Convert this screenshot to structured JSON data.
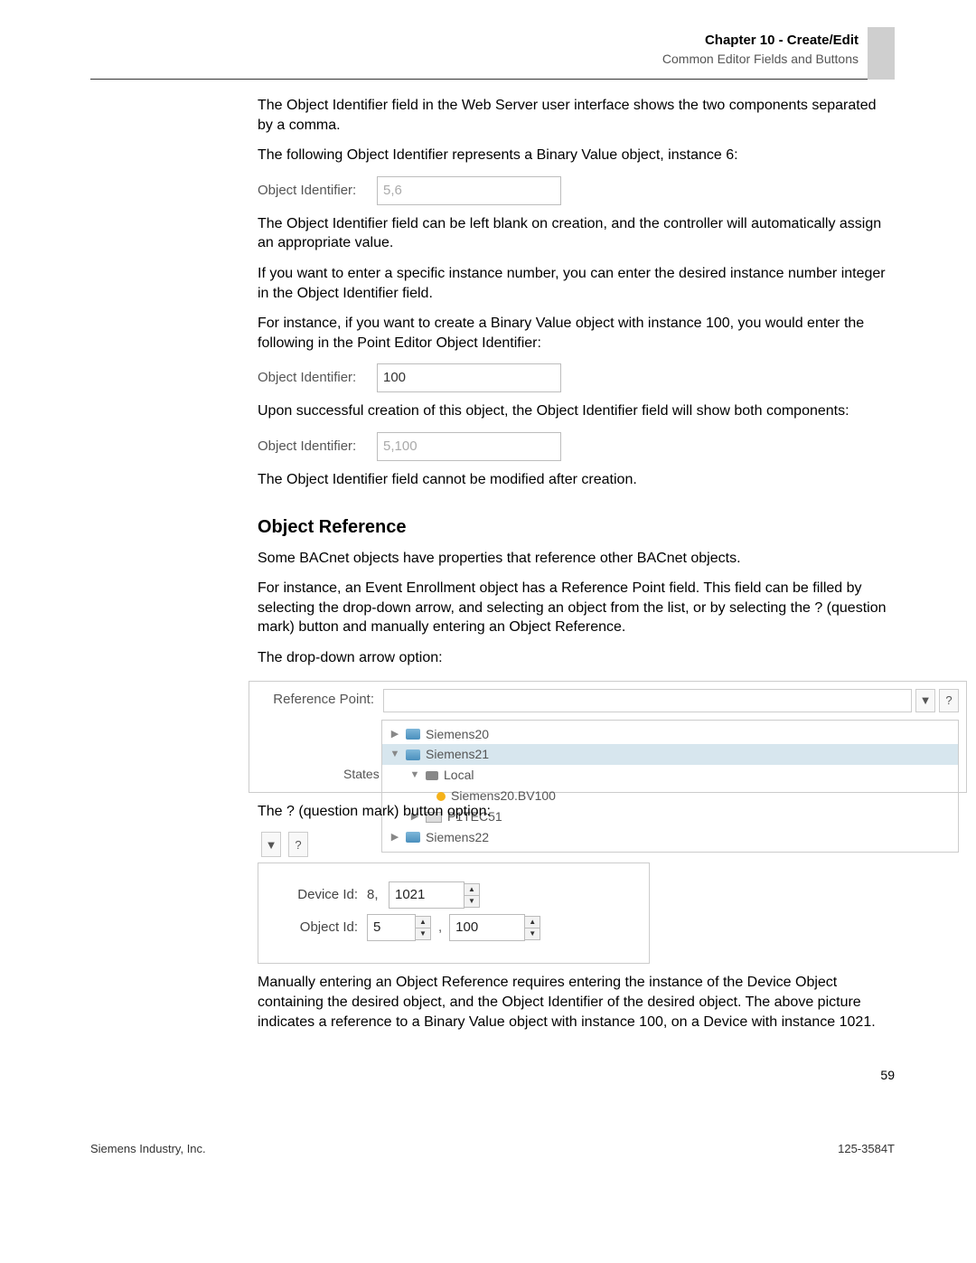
{
  "header": {
    "chapter": "Chapter 10 - Create/Edit",
    "subtitle": "Common Editor Fields and Buttons"
  },
  "body": {
    "p1": "The Object Identifier field in the Web Server user interface shows the two components separated by a comma.",
    "p2": "The following Object Identifier represents a Binary Value object, instance 6:",
    "oi_label": "Object Identifier:",
    "oi_val1": "5,6",
    "p3": "The Object Identifier field can be left blank on creation, and the controller will automatically assign an appropriate value.",
    "p4": "If you want to enter a specific instance number, you can enter the desired instance number integer in the Object Identifier field.",
    "p5": "For instance, if you want to create a Binary Value object with instance 100, you would enter the following in the Point Editor Object Identifier:",
    "oi_val2": "100",
    "p6": "Upon successful creation of this object, the Object Identifier field will show both components:",
    "oi_val3": "5,100",
    "p7": "The Object Identifier field cannot be modified after creation.",
    "h2": "Object Reference",
    "p8": "Some BACnet objects have properties that reference other BACnet objects.",
    "p9": "For instance, an Event Enrollment object has a Reference Point field. This field can be filled by selecting the drop-down arrow, and selecting an object from the list, or by selecting the ? (question mark) button and manually entering an Object Reference.",
    "p10": "The drop-down arrow option:",
    "refpoint": {
      "label": "Reference Point:",
      "states_label": "States",
      "qmark": "?",
      "tree": {
        "n0": "Siemens20",
        "n1": "Siemens21",
        "n2": "Local",
        "n3": "Siemens20.BV100",
        "n4": "P1TEC51",
        "n5": "Siemens22"
      }
    },
    "p11": "The ? (question mark) button option:",
    "qm": {
      "device_label": "Device Id:",
      "device_prefix": "8,",
      "device_val": "1021",
      "object_label": "Object Id:",
      "object_type": "5",
      "object_inst": "100"
    },
    "p12": "Manually entering an Object Reference requires entering the instance of the Device Object containing the desired object, and the Object Identifier of the desired object. The above picture indicates a reference to a Binary Value object with instance 100, on a Device with instance 1021."
  },
  "footer": {
    "left": "Siemens Industry, Inc.",
    "right": "125-3584T",
    "page": "59"
  }
}
